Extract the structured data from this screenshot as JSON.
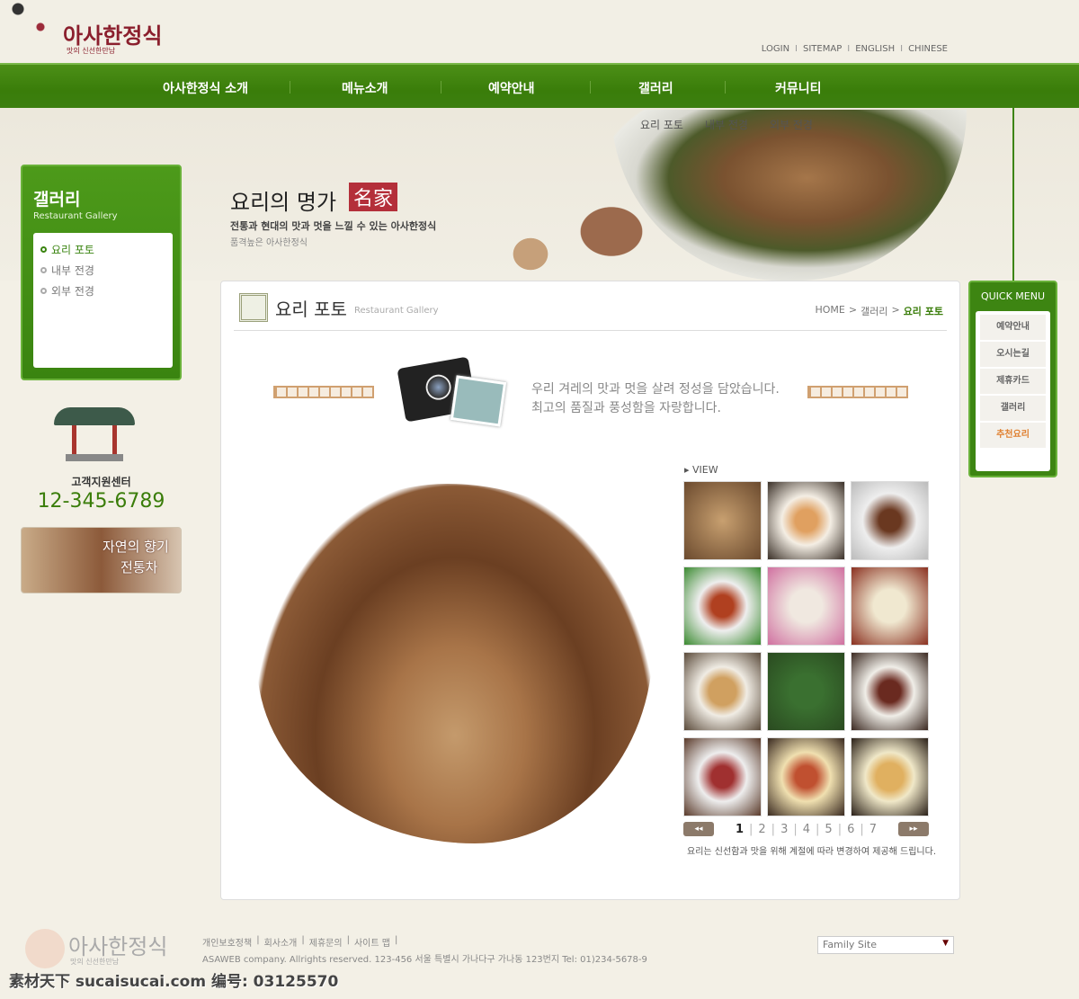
{
  "header": {
    "logo_title": "아사한정식",
    "logo_sub": "맛의 신선한만남",
    "util_links": [
      "LOGIN",
      "SITEMAP",
      "ENGLISH",
      "CHINESE"
    ]
  },
  "nav": {
    "items": [
      "아사한정식 소개",
      "메뉴소개",
      "예약안내",
      "갤러리",
      "커뮤니티"
    ]
  },
  "sub_menu": [
    "요리 포토",
    "내부 전경",
    "외부 전경"
  ],
  "banner": {
    "title": "요리의 명가",
    "hanja": "名家",
    "sub1": "전통과 현대의 맛과 멋을 느낄 수 있는 아사한정식",
    "sub2": "품격높은 아사한정식"
  },
  "sidebar": {
    "title": "갤러리",
    "subtitle": "Restaurant Gallery",
    "items": [
      {
        "label": "요리 포토",
        "active": true
      },
      {
        "label": "내부 전경"
      },
      {
        "label": "외부 전경"
      }
    ],
    "cs_label": "고객지원센터",
    "cs_phone": "12-345-6789",
    "tea_text1": "자연의 향기",
    "tea_text2": "전통차"
  },
  "main": {
    "title": "요리 포토",
    "title_en": "Restaurant Gallery",
    "breadcrumb": [
      "HOME",
      "갤러리",
      "요리 포토"
    ],
    "intro1": "우리 겨레의 맛과 멋을 살려 정성을 담았습니다.",
    "intro2": "최고의 품질과 풍성함을 자랑합니다.",
    "view_label": "▸ VIEW",
    "pages": [
      "1",
      "2",
      "3",
      "4",
      "5",
      "6",
      "7"
    ],
    "current_page": "1",
    "note": "요리는 신선함과 맛을 위해 계절에 따라 변경하여 제공해 드립니다.",
    "prev_icon": "◂◂",
    "next_icon": "▸▸"
  },
  "quick": {
    "title": "QUICK MENU",
    "items": [
      "예약안내",
      "오시는길",
      "제휴카드",
      "갤러리",
      "추천요리"
    ]
  },
  "footer": {
    "logo": "아사한정식",
    "logo_sub": "맛의 신선한만남",
    "links": [
      "개인보호정책",
      "회사소개",
      "제휴문의",
      "사이트 맵"
    ],
    "copyright": "ASAWEB company. Allrights reserved.  123-456 서울 특별시 가나다구 가나동 123번지 Tel: 01)234-5678-9",
    "family_site": "Family Site"
  },
  "watermark": "素材天下 sucaisucai.com  编号: 03125570",
  "colors": {
    "nav_green": "#3a7d0a",
    "accent_red": "#b42f3a",
    "highlight_orange": "#e08030"
  }
}
